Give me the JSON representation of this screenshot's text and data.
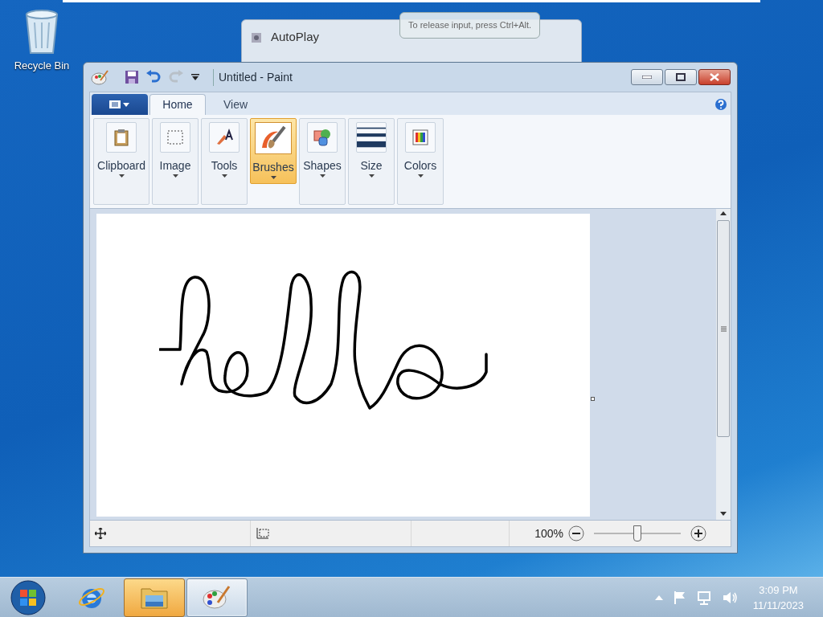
{
  "desktop": {
    "icons": [
      {
        "label": "Recycle Bin"
      }
    ]
  },
  "tooltip": {
    "text": "To release input, press Ctrl+Alt."
  },
  "background_window": {
    "title": "AutoPlay"
  },
  "paint": {
    "title": "Untitled - Paint",
    "tabs": [
      {
        "label": "Home",
        "selected": true
      },
      {
        "label": "View",
        "selected": false
      }
    ],
    "groups": [
      {
        "label": "Clipboard",
        "kind": "clipboard",
        "selected": false
      },
      {
        "label": "Image",
        "kind": "select",
        "selected": false
      },
      {
        "label": "Tools",
        "kind": "tools",
        "selected": false
      },
      {
        "label": "Brushes",
        "kind": "brush",
        "selected": true
      },
      {
        "label": "Shapes",
        "kind": "shapes",
        "selected": false
      },
      {
        "label": "Size",
        "kind": "size",
        "selected": false
      },
      {
        "label": "Colors",
        "kind": "colors",
        "selected": false
      }
    ],
    "status_bar": {
      "zoom": "100%",
      "level": 0.5
    }
  },
  "taskbar": {
    "apps": [
      {
        "kind": "browser",
        "highlighted": false,
        "active": false
      },
      {
        "kind": "folder",
        "highlighted": true,
        "active": false
      },
      {
        "kind": "paint",
        "highlighted": false,
        "active": true
      }
    ],
    "time": "3:09 PM",
    "date": "11/11/2023"
  }
}
